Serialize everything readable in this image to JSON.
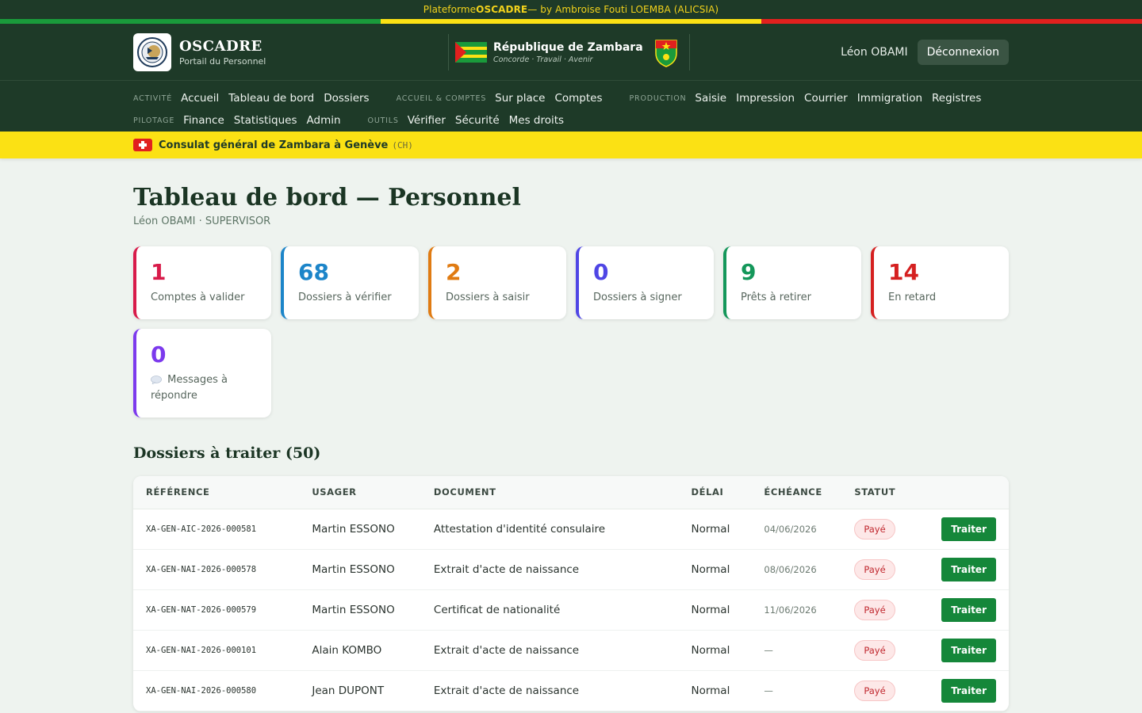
{
  "credit": {
    "prefix": "Plateforme ",
    "brand": "OSCADRE",
    "suffix": " — by Ambroise Fouti LOEMBA (ALICSIA)"
  },
  "colors": {
    "green": "#1a9a3b",
    "yellow": "#fbe114",
    "red": "#e1201e",
    "header_bg": "#1e3a28"
  },
  "header": {
    "brand_name": "OSCADRE",
    "brand_sub": "Portail du Personnel",
    "republic_name": "République de Zambara",
    "republic_motto": "Concorde · Travail · Avenir",
    "user_name": "Léon OBAMI",
    "logout_label": "Déconnexion"
  },
  "nav": {
    "row1": [
      {
        "category": "ACTIVITÉ",
        "links": [
          "Accueil",
          "Tableau de bord",
          "Dossiers"
        ]
      },
      {
        "category": "ACCUEIL & COMPTES",
        "links": [
          "Sur place",
          "Comptes"
        ]
      },
      {
        "category": "PRODUCTION",
        "links": [
          "Saisie",
          "Impression",
          "Courrier",
          "Immigration",
          "Registres"
        ]
      }
    ],
    "row2": [
      {
        "category": "PILOTAGE",
        "links": [
          "Finance",
          "Statistiques",
          "Admin"
        ]
      },
      {
        "category": "OUTILS",
        "links": [
          "Vérifier",
          "Sécurité",
          "Mes droits"
        ]
      }
    ]
  },
  "consulate": {
    "name": "Consulat général de Zambara à Genève",
    "code": "(CH)"
  },
  "page": {
    "title": "Tableau de bord — Personnel",
    "subtitle": "Léon OBAMI · SUPERVISOR"
  },
  "stats": [
    {
      "value": "1",
      "label": "Comptes à valider",
      "color": "#d81b4a"
    },
    {
      "value": "68",
      "label": "Dossiers à vérifier",
      "color": "#1c85c9"
    },
    {
      "value": "2",
      "label": "Dossiers à saisir",
      "color": "#e07b12"
    },
    {
      "value": "0",
      "label": "Dossiers à signer",
      "color": "#4f46e5"
    },
    {
      "value": "9",
      "label": "Prêts à retirer",
      "color": "#14975a"
    },
    {
      "value": "14",
      "label": "En retard",
      "color": "#d52020"
    },
    {
      "value": "0",
      "label": "Messages à répondre",
      "icon": "speech-bubble-icon",
      "color": "#7c3aed"
    }
  ],
  "section_title": "Dossiers à traiter (50)",
  "table": {
    "headers": [
      "RÉFÉRENCE",
      "USAGER",
      "DOCUMENT",
      "DÉLAI",
      "ÉCHÉANCE",
      "STATUT",
      ""
    ],
    "rows": [
      {
        "ref": "XA-GEN-AIC-2026-000581",
        "user": "Martin ESSONO",
        "doc": "Attestation d'identité consulaire",
        "delay": "Normal",
        "due": "04/06/2026",
        "status": "Payé",
        "action": "Traiter"
      },
      {
        "ref": "XA-GEN-NAI-2026-000578",
        "user": "Martin ESSONO",
        "doc": "Extrait d'acte de naissance",
        "delay": "Normal",
        "due": "08/06/2026",
        "status": "Payé",
        "action": "Traiter"
      },
      {
        "ref": "XA-GEN-NAT-2026-000579",
        "user": "Martin ESSONO",
        "doc": "Certificat de nationalité",
        "delay": "Normal",
        "due": "11/06/2026",
        "status": "Payé",
        "action": "Traiter"
      },
      {
        "ref": "XA-GEN-NAI-2026-000101",
        "user": "Alain KOMBO",
        "doc": "Extrait d'acte de naissance",
        "delay": "Normal",
        "due": "—",
        "status": "Payé",
        "action": "Traiter"
      },
      {
        "ref": "XA-GEN-NAI-2026-000580",
        "user": "Jean DUPONT",
        "doc": "Extrait d'acte de naissance",
        "delay": "Normal",
        "due": "—",
        "status": "Payé",
        "action": "Traiter"
      }
    ]
  }
}
